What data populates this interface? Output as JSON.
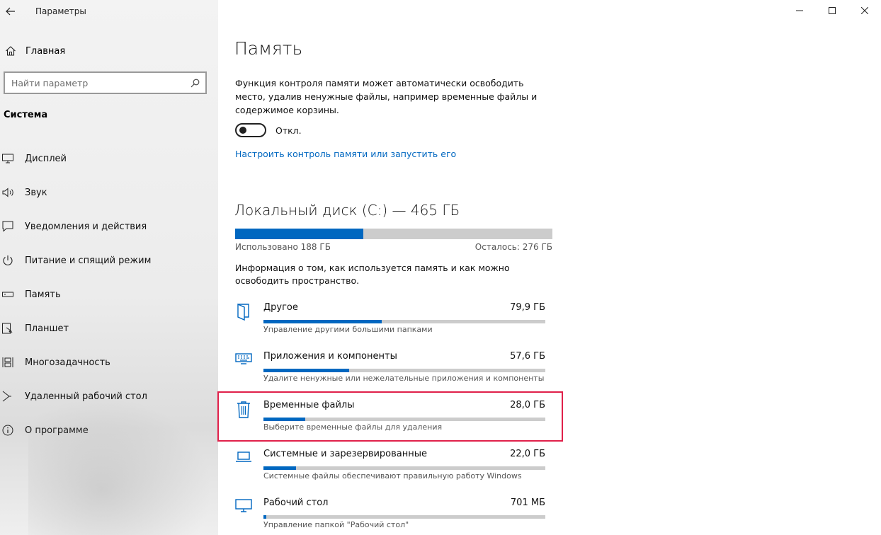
{
  "window": {
    "title": "Параметры"
  },
  "sidebar": {
    "home_label": "Главная",
    "search_placeholder": "Найти параметр",
    "section_title": "Система",
    "items": [
      {
        "label": "Дисплей",
        "icon": "display-icon"
      },
      {
        "label": "Звук",
        "icon": "sound-icon"
      },
      {
        "label": "Уведомления и действия",
        "icon": "notifications-icon"
      },
      {
        "label": "Питание и спящий режим",
        "icon": "power-icon"
      },
      {
        "label": "Память",
        "icon": "storage-icon"
      },
      {
        "label": "Планшет",
        "icon": "tablet-icon"
      },
      {
        "label": "Многозадачность",
        "icon": "multitasking-icon"
      },
      {
        "label": "Удаленный рабочий стол",
        "icon": "remote-desktop-icon"
      },
      {
        "label": "О программе",
        "icon": "info-icon"
      }
    ]
  },
  "main": {
    "title": "Память",
    "description": "Функция контроля памяти может автоматически освободить место, удалив ненужные файлы, например временные файлы и содержимое корзины.",
    "toggle_label": "Откл.",
    "toggle_on": false,
    "link": "Настроить контроль памяти или запустить его",
    "disk": {
      "title": "Локальный диск (C:) — 465 ГБ",
      "used_label": "Использовано 188 ГБ",
      "free_label": "Осталось: 276 ГБ",
      "used_fraction": 0.4043
    },
    "info": "Информация о том, как используется память и как можно освободить пространство.",
    "categories": [
      {
        "name": "Другое",
        "size": "79,9 ГБ",
        "desc": "Управление другими большими папками",
        "fraction": 0.42,
        "icon": "folder-icon"
      },
      {
        "name": "Приложения и компоненты",
        "size": "57,6 ГБ",
        "desc": "Удалите ненужные или нежелательные приложения и компоненты",
        "fraction": 0.305,
        "icon": "keyboard-icon"
      },
      {
        "name": "Временные файлы",
        "size": "28,0 ГБ",
        "desc": "Выберите временные файлы для удаления",
        "fraction": 0.148,
        "icon": "trash-icon"
      },
      {
        "name": "Системные и зарезервированные",
        "size": "22,0 ГБ",
        "desc": "Системные файлы обеспечивают правильную работу Windows",
        "fraction": 0.116,
        "icon": "laptop-icon"
      },
      {
        "name": "Рабочий стол",
        "size": "701 МБ",
        "desc": "Управление папкой \"Рабочий стол\"",
        "fraction": 0.01,
        "icon": "monitor-icon"
      }
    ]
  },
  "colors": {
    "accent": "#0067c0",
    "bar_track": "#cccccc",
    "highlight": "#e0204a"
  }
}
